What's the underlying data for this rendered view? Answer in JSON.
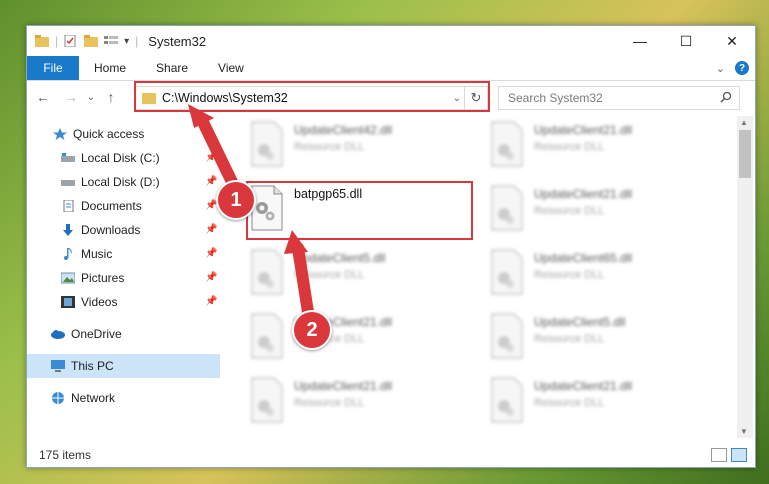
{
  "window": {
    "title": "System32"
  },
  "controls": {
    "minimize": "—",
    "maximize": "☐",
    "close": "✕"
  },
  "ribbon": {
    "tabs": [
      "File",
      "Home",
      "Share",
      "View"
    ],
    "help": "?"
  },
  "nav": {
    "back": "←",
    "forward": "→",
    "recent": "⌄",
    "up": "↑"
  },
  "address": {
    "path": "C:\\Windows\\System32",
    "dropdown": "⌄",
    "refresh": "↻"
  },
  "search": {
    "placeholder": "Search System32"
  },
  "sidebar": {
    "items": [
      {
        "label": "Quick access",
        "icon": "star-icon",
        "pinned": false
      },
      {
        "label": "Local Disk (C:)",
        "icon": "drive-icon",
        "pinned": true
      },
      {
        "label": "Local Disk (D:)",
        "icon": "drive-icon",
        "pinned": true
      },
      {
        "label": "Documents",
        "icon": "documents-icon",
        "pinned": true
      },
      {
        "label": "Downloads",
        "icon": "download-icon",
        "pinned": true
      },
      {
        "label": "Music",
        "icon": "music-icon",
        "pinned": true
      },
      {
        "label": "Pictures",
        "icon": "pictures-icon",
        "pinned": true
      },
      {
        "label": "Videos",
        "icon": "videos-icon",
        "pinned": true
      },
      {
        "label": "OneDrive",
        "icon": "cloud-icon",
        "pinned": false
      },
      {
        "label": "This PC",
        "icon": "computer-icon",
        "pinned": false
      },
      {
        "label": "Network",
        "icon": "network-icon",
        "pinned": false
      }
    ]
  },
  "files": [
    {
      "name": "UpdateClient42.dll",
      "type": "Resource DLL",
      "blurred": true
    },
    {
      "name": "UpdateClient21.dll",
      "type": "Resource DLL",
      "blurred": true
    },
    {
      "name": "batpgp65.dll",
      "type": "",
      "blurred": false
    },
    {
      "name": "UpdateClient21.dll",
      "type": "Resource DLL",
      "blurred": true
    },
    {
      "name": "UpdateClient5.dll",
      "type": "Resource DLL",
      "blurred": true
    },
    {
      "name": "UpdateClient65.dll",
      "type": "Resource DLL",
      "blurred": true
    },
    {
      "name": "UpdateClient21.dll",
      "type": "Resource DLL",
      "blurred": true
    },
    {
      "name": "UpdateClient5.dll",
      "type": "Resource DLL",
      "blurred": true
    },
    {
      "name": "UpdateClient21.dll",
      "type": "Resource DLL",
      "blurred": true
    },
    {
      "name": "UpdateClient21.dll",
      "type": "Resource DLL",
      "blurred": true
    }
  ],
  "status": {
    "count": "175 items"
  },
  "annotations": {
    "step1": "1",
    "step2": "2"
  },
  "colors": {
    "accent": "#1979ca",
    "highlight": "#d9373b",
    "selection": "#cce4f7"
  }
}
